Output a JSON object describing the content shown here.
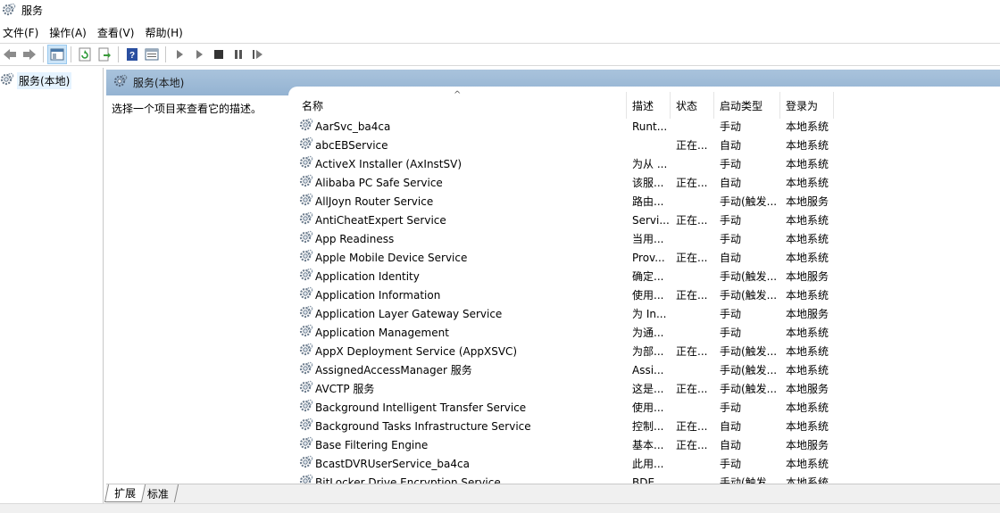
{
  "window": {
    "title": "服务"
  },
  "menu": [
    "文件(F)",
    "操作(A)",
    "查看(V)",
    "帮助(H)"
  ],
  "tree": {
    "root_label": "服务(本地)"
  },
  "right_header": {
    "title": "服务(本地)"
  },
  "desc_text": "选择一个项目来查看它的描述。",
  "columns": {
    "name": "名称",
    "desc": "描述",
    "status": "状态",
    "startup": "启动类型",
    "logon": "登录为"
  },
  "services": [
    {
      "name": "AarSvc_ba4ca",
      "desc": "Runt...",
      "status": "",
      "startup": "手动",
      "logon": "本地系统"
    },
    {
      "name": "abcEBService",
      "desc": "",
      "status": "正在...",
      "startup": "自动",
      "logon": "本地系统"
    },
    {
      "name": "ActiveX Installer (AxInstSV)",
      "desc": "为从 ...",
      "status": "",
      "startup": "手动",
      "logon": "本地系统"
    },
    {
      "name": "Alibaba PC Safe Service",
      "desc": "该服...",
      "status": "正在...",
      "startup": "自动",
      "logon": "本地系统"
    },
    {
      "name": "AllJoyn Router Service",
      "desc": "路由...",
      "status": "",
      "startup": "手动(触发...",
      "logon": "本地服务"
    },
    {
      "name": "AntiCheatExpert Service",
      "desc": "Servi...",
      "status": "正在...",
      "startup": "手动",
      "logon": "本地系统"
    },
    {
      "name": "App Readiness",
      "desc": "当用...",
      "status": "",
      "startup": "手动",
      "logon": "本地系统"
    },
    {
      "name": "Apple Mobile Device Service",
      "desc": "Prov...",
      "status": "正在...",
      "startup": "自动",
      "logon": "本地系统"
    },
    {
      "name": "Application Identity",
      "desc": "确定...",
      "status": "",
      "startup": "手动(触发...",
      "logon": "本地服务"
    },
    {
      "name": "Application Information",
      "desc": "使用...",
      "status": "正在...",
      "startup": "手动(触发...",
      "logon": "本地系统"
    },
    {
      "name": "Application Layer Gateway Service",
      "desc": "为 In...",
      "status": "",
      "startup": "手动",
      "logon": "本地服务"
    },
    {
      "name": "Application Management",
      "desc": "为通...",
      "status": "",
      "startup": "手动",
      "logon": "本地系统"
    },
    {
      "name": "AppX Deployment Service (AppXSVC)",
      "desc": "为部...",
      "status": "正在...",
      "startup": "手动(触发...",
      "logon": "本地系统"
    },
    {
      "name": "AssignedAccessManager 服务",
      "desc": "Assi...",
      "status": "",
      "startup": "手动(触发...",
      "logon": "本地系统"
    },
    {
      "name": "AVCTP 服务",
      "desc": "这是...",
      "status": "正在...",
      "startup": "手动(触发...",
      "logon": "本地服务"
    },
    {
      "name": "Background Intelligent Transfer Service",
      "desc": "使用...",
      "status": "",
      "startup": "手动",
      "logon": "本地系统"
    },
    {
      "name": "Background Tasks Infrastructure Service",
      "desc": "控制...",
      "status": "正在...",
      "startup": "自动",
      "logon": "本地系统"
    },
    {
      "name": "Base Filtering Engine",
      "desc": "基本...",
      "status": "正在...",
      "startup": "自动",
      "logon": "本地服务"
    },
    {
      "name": "BcastDVRUserService_ba4ca",
      "desc": "此用...",
      "status": "",
      "startup": "手动",
      "logon": "本地系统"
    },
    {
      "name": "BitLocker Drive Encryption Service",
      "desc": "BDE...",
      "status": "",
      "startup": "手动(触发...",
      "logon": "本地系统"
    }
  ],
  "bottom_tabs": [
    "扩展",
    "标准"
  ]
}
